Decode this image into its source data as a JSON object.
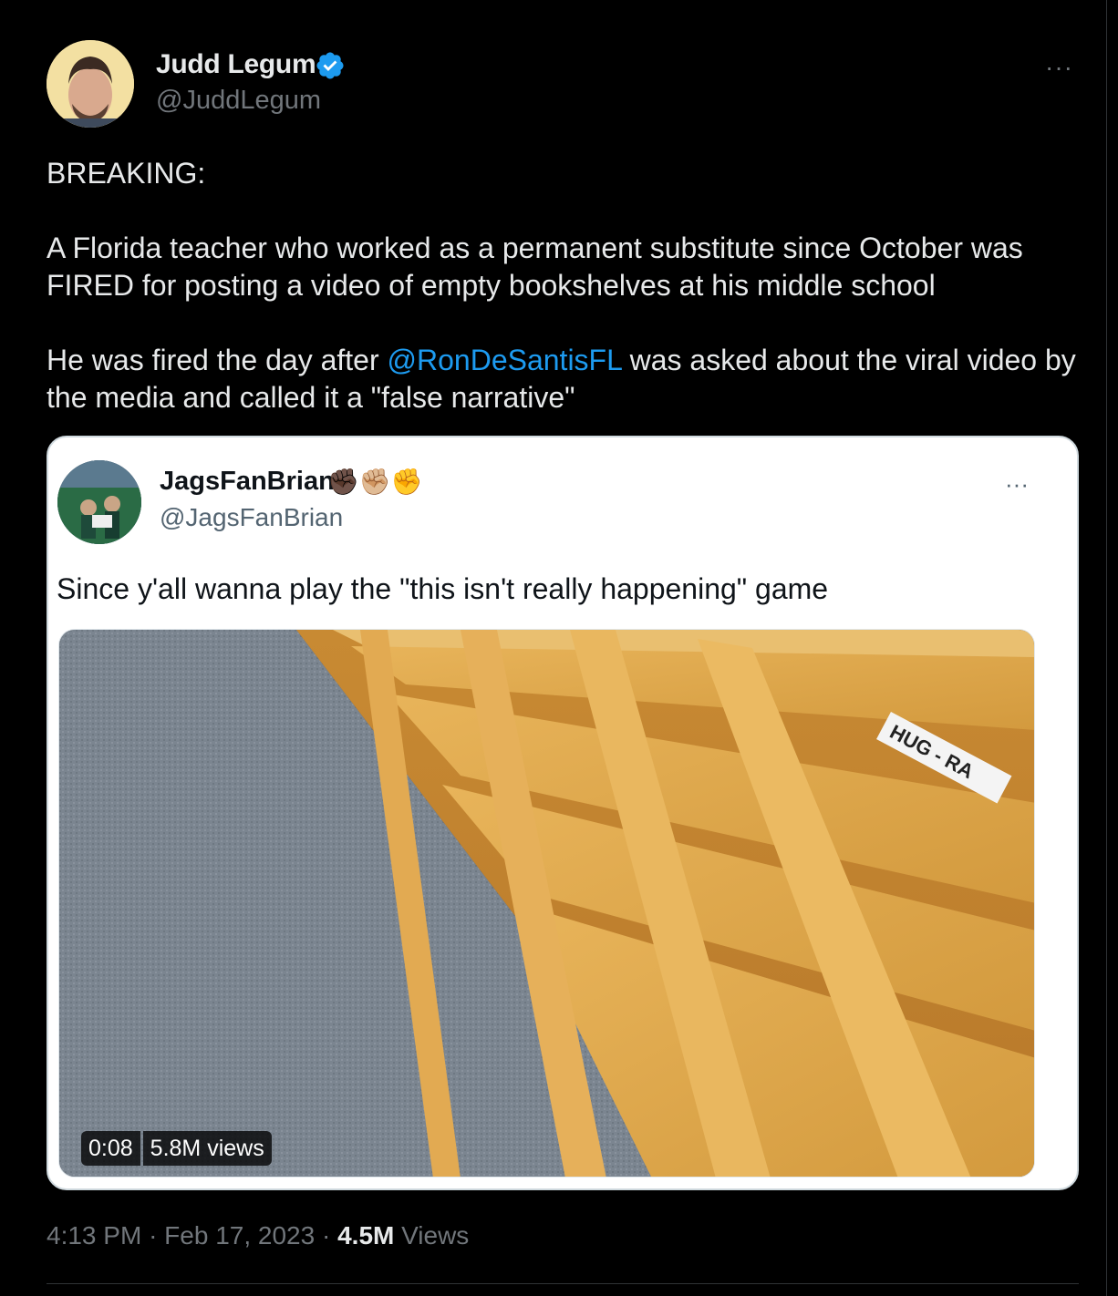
{
  "tweet": {
    "author_name": "Judd Legum",
    "author_handle": "@JuddLegum",
    "more_label": "···",
    "body": {
      "line1": "BREAKING:",
      "para2": "A Florida teacher who worked as a permanent substitute since October was FIRED for posting a video of empty bookshelves at his middle school",
      "para3_before": "He was fired the day after ",
      "para3_mention": "@RonDeSantisFL",
      "para3_after": " was asked about the viral video by the media and called it a \"false narrative\""
    },
    "time": "4:13 PM",
    "date": "Feb 17, 2023",
    "views_count": "4.5M",
    "views_label": "Views"
  },
  "quote": {
    "author_name": "JagsFanBrian",
    "author_emoji": "✊🏿✊🏼✊",
    "author_handle": "@JagsFanBrian",
    "more_label": "···",
    "text": "Since y'all wanna play the \"this isn't really happening\" game",
    "video": {
      "duration": "0:08",
      "views": "5.8M views",
      "shelf_label": "HUG - RA"
    }
  },
  "colors": {
    "background": "#000000",
    "text_primary": "#e7e9ea",
    "text_secondary": "#71767b",
    "link": "#1d9bf0",
    "verified": "#1d9bf0"
  }
}
